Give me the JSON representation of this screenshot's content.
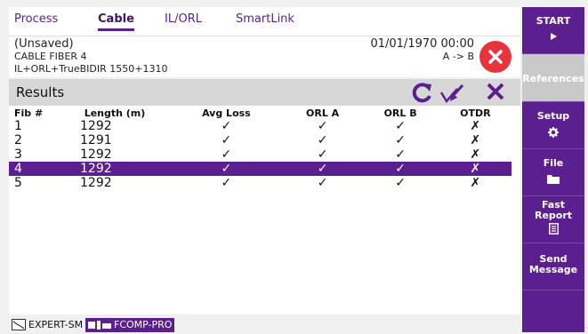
{
  "tabs": [
    "Process",
    "Cable",
    "IL/ORL",
    "SmartLink"
  ],
  "active_tab": "Cable",
  "info": {
    "status": "(Unsaved)",
    "cable": "CABLE FIBER 4",
    "mode": "IL+ORL+TrueBIDIR 1550+1310",
    "datetime": "01/01/1970 00:00",
    "direction": "A -> B"
  },
  "results": {
    "title": "Results",
    "columns": [
      "Fib #",
      "Length (m)",
      "Avg Loss",
      "ORL A",
      "ORL B",
      "OTDR"
    ],
    "rows": [
      {
        "fib": "1",
        "length": "1292",
        "avg_loss": "✓",
        "orl_a": "✓",
        "orl_b": "✓",
        "otdr": "✗"
      },
      {
        "fib": "2",
        "length": "1291",
        "avg_loss": "✓",
        "orl_a": "✓",
        "orl_b": "✓",
        "otdr": "✗"
      },
      {
        "fib": "3",
        "length": "1292",
        "avg_loss": "✓",
        "orl_a": "✓",
        "orl_b": "✓",
        "otdr": "✗"
      },
      {
        "fib": "4",
        "length": "1292",
        "avg_loss": "✓",
        "orl_a": "✓",
        "orl_b": "✓",
        "otdr": "✗"
      },
      {
        "fib": "5",
        "length": "1292",
        "avg_loss": "✓",
        "orl_a": "✓",
        "orl_b": "✓",
        "otdr": "✗"
      }
    ],
    "selected_row": "4"
  },
  "status_bar": {
    "item1": "EXPERT-SM",
    "item2": "FCOMP-PRO"
  },
  "sidebar": {
    "start": "START",
    "references": "References",
    "setup": "Setup",
    "file": "File",
    "fast_report_1": "Fast",
    "fast_report_2": "Report",
    "send_message_1": "Send",
    "send_message_2": "Message"
  },
  "colors": {
    "accent": "#5c1f8f",
    "pass": "#3aa52c",
    "fail": "#e8323c"
  }
}
